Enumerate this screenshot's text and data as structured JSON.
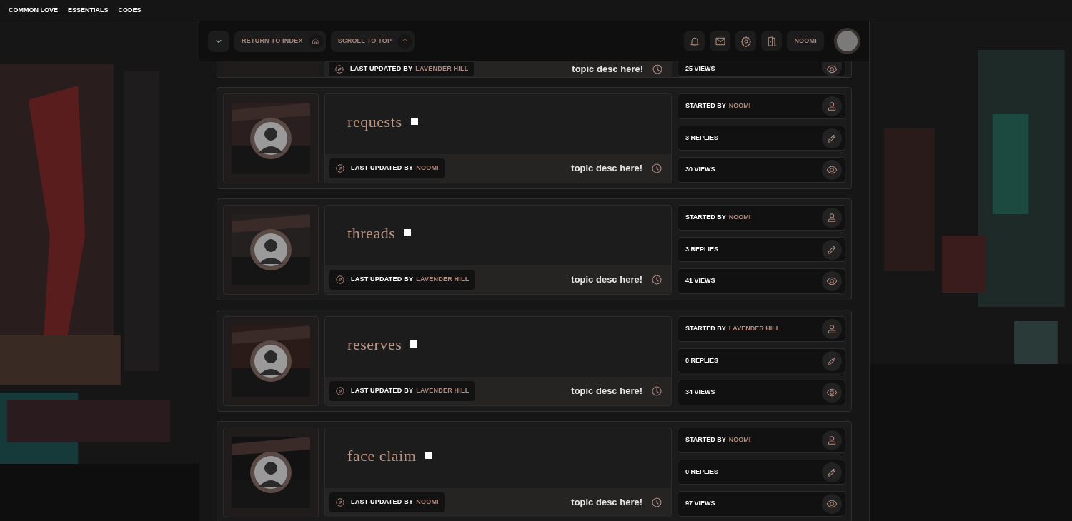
{
  "top_nav": [
    {
      "label": "COMMON LOVE"
    },
    {
      "label": "ESSENTIALS"
    },
    {
      "label": "CODES"
    }
  ],
  "header": {
    "buttons": [
      {
        "label": "RETURN TO INDEX"
      },
      {
        "label": "SCROLL TO TOP"
      }
    ],
    "user": "NOOMI"
  },
  "partial_topic": {
    "last_updated_label": "LAST UPDATED BY",
    "last_updated_by": "LAVENDER HILL",
    "desc": "topic desc here!",
    "views": "25 VIEWS"
  },
  "topics": [
    {
      "title": "requests",
      "last_updated_label": "LAST UPDATED BY",
      "last_updated_by": "NOOMI",
      "desc": "topic desc here!",
      "started_label": "STARTED BY",
      "started_by": "NOOMI",
      "replies": "3 REPLIES",
      "views": "30 VIEWS"
    },
    {
      "title": "threads",
      "last_updated_label": "LAST UPDATED BY",
      "last_updated_by": "LAVENDER HILL",
      "desc": "topic desc here!",
      "started_label": "STARTED BY",
      "started_by": "NOOMI",
      "replies": "3 REPLIES",
      "views": "41 VIEWS"
    },
    {
      "title": "reserves",
      "last_updated_label": "LAST UPDATED BY",
      "last_updated_by": "LAVENDER HILL",
      "desc": "topic desc here!",
      "started_label": "STARTED BY",
      "started_by": "LAVENDER HILL",
      "replies": "0 REPLIES",
      "views": "34 VIEWS"
    },
    {
      "title": "face claim",
      "last_updated_label": "LAST UPDATED BY",
      "last_updated_by": "NOOMI",
      "desc": "topic desc here!",
      "started_label": "STARTED BY",
      "started_by": "NOOMI",
      "replies": "0 REPLIES",
      "views": "97 VIEWS"
    }
  ]
}
